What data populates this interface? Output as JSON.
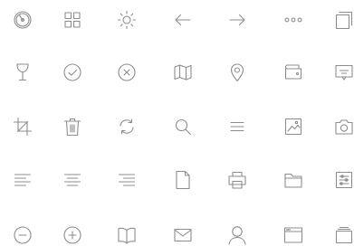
{
  "stroke_color": "#8c8c8c",
  "icons": [
    [
      "speedometer-icon",
      "grid-icon",
      "brightness-icon",
      "arrow-left-icon",
      "arrow-right-icon",
      "more-horizontal-icon",
      "copy-icon"
    ],
    [
      "wine-glass-icon",
      "check-circle-icon",
      "close-circle-icon",
      "map-icon",
      "location-pin-icon",
      "wallet-icon",
      "message-icon"
    ],
    [
      "crop-icon",
      "trash-icon",
      "refresh-icon",
      "search-icon",
      "menu-icon",
      "image-icon",
      "camera-icon"
    ],
    [
      "align-left-icon",
      "align-center-icon",
      "align-right-icon",
      "document-icon",
      "printer-icon",
      "folder-icon",
      "sliders-icon"
    ],
    [
      "minus-circle-icon",
      "plus-circle-icon",
      "book-open-icon",
      "mail-icon",
      "user-icon",
      "browser-window-icon",
      "layers-icon"
    ]
  ]
}
